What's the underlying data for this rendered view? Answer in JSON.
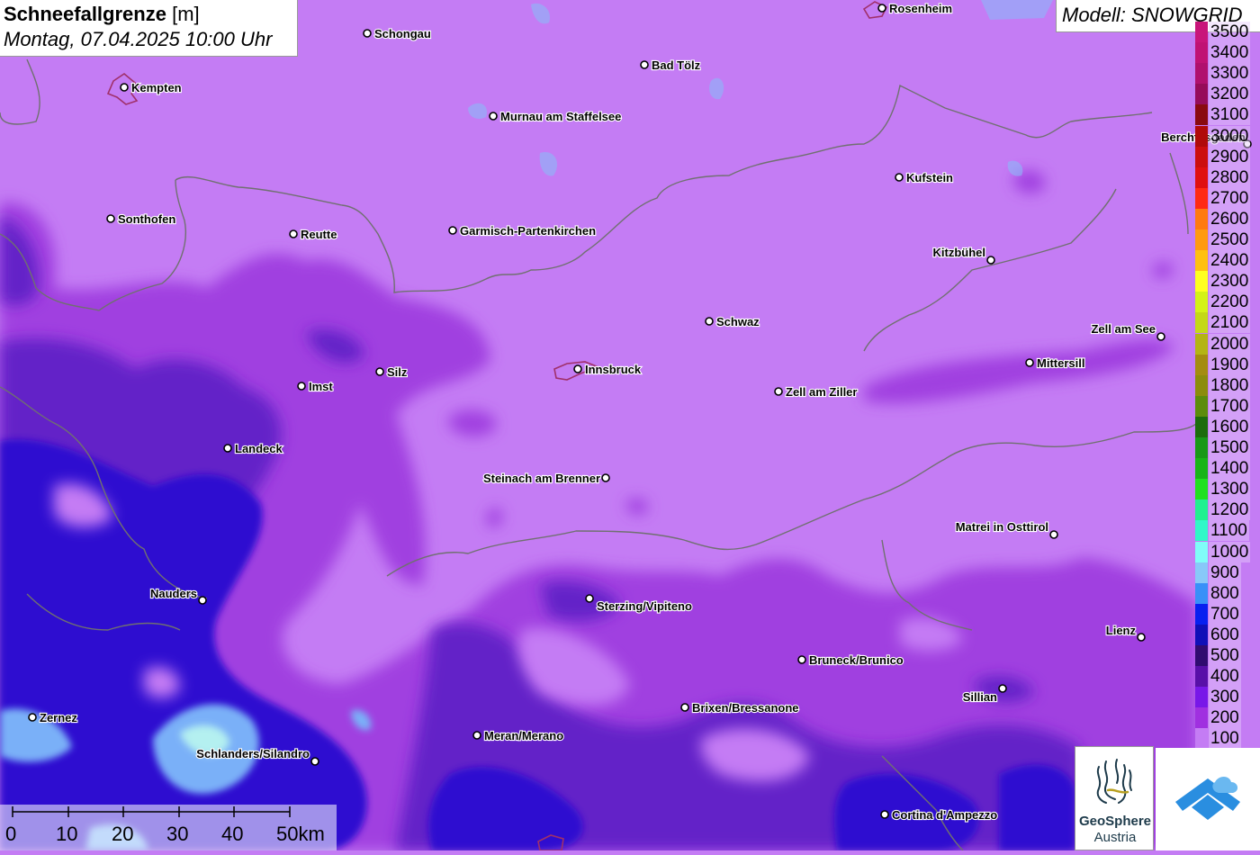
{
  "title": {
    "parameter": "Schneefallgrenze",
    "unit": "[m]",
    "datetime": "Montag, 07.04.2025 10:00 Uhr"
  },
  "model_label": "Modell: SNOWGRID",
  "legend": {
    "levels": [
      {
        "label": "3500",
        "color": "#c8157a"
      },
      {
        "label": "3400",
        "color": "#c01274"
      },
      {
        "label": "3300",
        "color": "#b0106e"
      },
      {
        "label": "3200",
        "color": "#960c5a"
      },
      {
        "label": "3100",
        "color": "#8a0a10"
      },
      {
        "label": "3000",
        "color": "#b00a0a"
      },
      {
        "label": "2900",
        "color": "#cc0e0e"
      },
      {
        "label": "2800",
        "color": "#e01010"
      },
      {
        "label": "2700",
        "color": "#ff2a14"
      },
      {
        "label": "2600",
        "color": "#ff7a10"
      },
      {
        "label": "2500",
        "color": "#ff9a10"
      },
      {
        "label": "2400",
        "color": "#ffc010"
      },
      {
        "label": "2300",
        "color": "#ffff20"
      },
      {
        "label": "2200",
        "color": "#d4f218"
      },
      {
        "label": "2100",
        "color": "#c4d818"
      },
      {
        "label": "2000",
        "color": "#b4b414"
      },
      {
        "label": "1900",
        "color": "#a48c10"
      },
      {
        "label": "1800",
        "color": "#8c8c0c"
      },
      {
        "label": "1700",
        "color": "#5c8c0c"
      },
      {
        "label": "1600",
        "color": "#1c6c0c"
      },
      {
        "label": "1500",
        "color": "#189818"
      },
      {
        "label": "1400",
        "color": "#18b418"
      },
      {
        "label": "1300",
        "color": "#20e020"
      },
      {
        "label": "1200",
        "color": "#20f090"
      },
      {
        "label": "1100",
        "color": "#30f8c8"
      },
      {
        "label": "1000",
        "color": "#80fcf8"
      },
      {
        "label": "900",
        "color": "#88c8f8"
      },
      {
        "label": "800",
        "color": "#3890f8"
      },
      {
        "label": "700",
        "color": "#0820f0"
      },
      {
        "label": "600",
        "color": "#1010b8"
      },
      {
        "label": "500",
        "color": "#300c70"
      },
      {
        "label": "400",
        "color": "#5810a8"
      },
      {
        "label": "300",
        "color": "#7818e8"
      },
      {
        "label": "200",
        "color": "#a030e0"
      },
      {
        "label": "100",
        "color": "#c47cf4"
      }
    ]
  },
  "cities": [
    {
      "name": "Rosenheim",
      "label_side": "right"
    },
    {
      "name": "Schongau",
      "label_side": "right"
    },
    {
      "name": "Kempten",
      "label_side": "right"
    },
    {
      "name": "Bad Tölz",
      "label_side": "right"
    },
    {
      "name": "Murnau am Staffelsee",
      "label_side": "right"
    },
    {
      "name": "Berchtesgaden",
      "label_side": "left"
    },
    {
      "name": "Kufstein",
      "label_side": "right"
    },
    {
      "name": "Sonthofen",
      "label_side": "right"
    },
    {
      "name": "Reutte",
      "label_side": "right"
    },
    {
      "name": "Garmisch-Partenkirchen",
      "label_side": "right"
    },
    {
      "name": "Kitzbühel",
      "label_side": "left"
    },
    {
      "name": "Schwaz",
      "label_side": "right"
    },
    {
      "name": "Zell am See",
      "label_side": "left"
    },
    {
      "name": "Mittersill",
      "label_side": "right"
    },
    {
      "name": "Innsbruck",
      "label_side": "right"
    },
    {
      "name": "Silz",
      "label_side": "right"
    },
    {
      "name": "Imst",
      "label_side": "right"
    },
    {
      "name": "Zell am Ziller",
      "label_side": "right"
    },
    {
      "name": "Landeck",
      "label_side": "right"
    },
    {
      "name": "Steinach am Brenner",
      "label_side": "left"
    },
    {
      "name": "Matrei in Osttirol",
      "label_side": "left"
    },
    {
      "name": "Nauders",
      "label_side": "left"
    },
    {
      "name": "Sterzing/Vipiteno",
      "label_side": "right"
    },
    {
      "name": "Lienz",
      "label_side": "left"
    },
    {
      "name": "Bruneck/Brunico",
      "label_side": "right"
    },
    {
      "name": "Sillian",
      "label_side": "left"
    },
    {
      "name": "Brixen/Bressanone",
      "label_side": "right"
    },
    {
      "name": "Zernez",
      "label_side": "right"
    },
    {
      "name": "Meran/Merano",
      "label_side": "right"
    },
    {
      "name": "Schlanders/Silandro",
      "label_side": "left"
    },
    {
      "name": "Cortina d'Ampezzo",
      "label_side": "right"
    }
  ],
  "scalebar": {
    "ticks": [
      "0",
      "10",
      "20",
      "30",
      "40",
      "50km"
    ]
  },
  "logos": {
    "geosphere_name": "GeoSphere",
    "geosphere_country": "Austria"
  }
}
